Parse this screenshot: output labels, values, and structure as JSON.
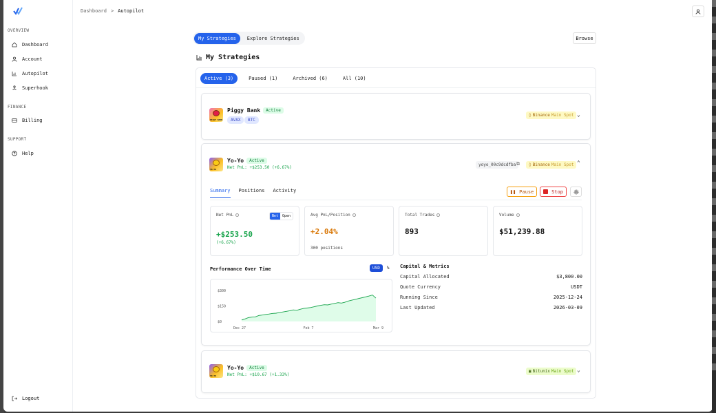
{
  "sidebar": {
    "groups": [
      {
        "label": "OVERVIEW",
        "items": [
          {
            "label": "Dashboard",
            "icon": "home-icon"
          },
          {
            "label": "Account",
            "icon": "user-icon"
          },
          {
            "label": "Autopilot",
            "icon": "chart-icon"
          },
          {
            "label": "Superhook",
            "icon": "hook-icon"
          }
        ]
      },
      {
        "label": "FINANCE",
        "items": [
          {
            "label": "Billing",
            "icon": "card-icon"
          }
        ]
      },
      {
        "label": "SUPPORT",
        "items": [
          {
            "label": "Help",
            "icon": "help-icon"
          }
        ]
      }
    ],
    "logout": "Logout"
  },
  "breadcrumb": {
    "parent": "Dashboard",
    "separator": ">",
    "current": "Autopilot"
  },
  "segment": {
    "items": [
      "My Strategies",
      "Explore Strategies"
    ],
    "active": 0
  },
  "browse_label": "Browse",
  "section_title": "My Strategies",
  "filter_tabs": [
    "Active (3)",
    "Paused (1)",
    "Archived (6)",
    "All (10)"
  ],
  "strategies": [
    {
      "name": "Piggy Bank",
      "status": "Active",
      "tokens": [
        "AVAX",
        "BTC"
      ],
      "exchange": "Binance",
      "market": "Main Spot",
      "thumb_text": "PIGGY BANK"
    },
    {
      "name": "Yo-Yo",
      "status": "Active",
      "pnl": "Net PnL: +$253.50 (+6.67%)",
      "id": "yoyo_00c9dcdfba",
      "exchange": "Binance",
      "market": "Main Spot",
      "thumb_text": "YO-YO",
      "tabs": [
        "Summary",
        "Positions",
        "Activity"
      ],
      "actions": {
        "pause": "Pause",
        "stop": "Stop"
      },
      "metrics": {
        "net_pnl": {
          "label": "Net PnL",
          "value": "+$253.50",
          "sub": "(+6.67%)",
          "toggle": [
            "Net",
            "Open"
          ]
        },
        "avg": {
          "label": "Avg PnL/Position",
          "value": "+2.04%",
          "sub": "300 positions"
        },
        "trades": {
          "label": "Total Trades",
          "value": "893"
        },
        "volume": {
          "label": "Volume",
          "value": "$51,239.88"
        }
      },
      "performance": {
        "title": "Performance Over Time",
        "toggle": [
          "USD",
          "%"
        ]
      },
      "capital": {
        "title": "Capital & Metrics",
        "rows": [
          {
            "label": "Capital Allocated",
            "value": "$3,800.00"
          },
          {
            "label": "Quote Currency",
            "value": "USDT"
          },
          {
            "label": "Running Since",
            "value": "2025-12-24"
          },
          {
            "label": "Last Updated",
            "value": "2026-03-09"
          }
        ]
      }
    },
    {
      "name": "Yo-Yo",
      "status": "Active",
      "pnl": "Net PnL: +$10.67 (+1.33%)",
      "exchange": "Bitunix",
      "market": "Main Spot",
      "thumb_text": "YO-YO"
    }
  ],
  "chart_data": {
    "type": "area",
    "title": "",
    "yticks": [
      "$300",
      "$150",
      "$0"
    ],
    "xticks": [
      "Dec 27",
      "Feb 7",
      "Mar 9"
    ],
    "ylim": [
      0,
      300
    ],
    "x": [
      0,
      2,
      4,
      6,
      8,
      10,
      12,
      14,
      16,
      18,
      20,
      22,
      24,
      26,
      28,
      30,
      32,
      34,
      36,
      38,
      40,
      42,
      44,
      46,
      48,
      50,
      52,
      54,
      56,
      58,
      60,
      62,
      64,
      66,
      68,
      70,
      72,
      74,
      76,
      78
    ],
    "values": [
      15,
      25,
      38,
      42,
      45,
      58,
      62,
      68,
      72,
      78,
      80,
      86,
      92,
      98,
      104,
      112,
      108,
      118,
      126,
      130,
      135,
      142,
      150,
      156,
      162,
      160,
      168,
      175,
      182,
      178,
      186,
      198,
      206,
      214,
      222,
      230,
      238,
      246,
      256,
      226
    ],
    "color": "#16a34a"
  },
  "colors": {
    "accent": "#2563eb",
    "positive": "#16a34a",
    "warning": "#d97706",
    "danger": "#dc2626"
  }
}
